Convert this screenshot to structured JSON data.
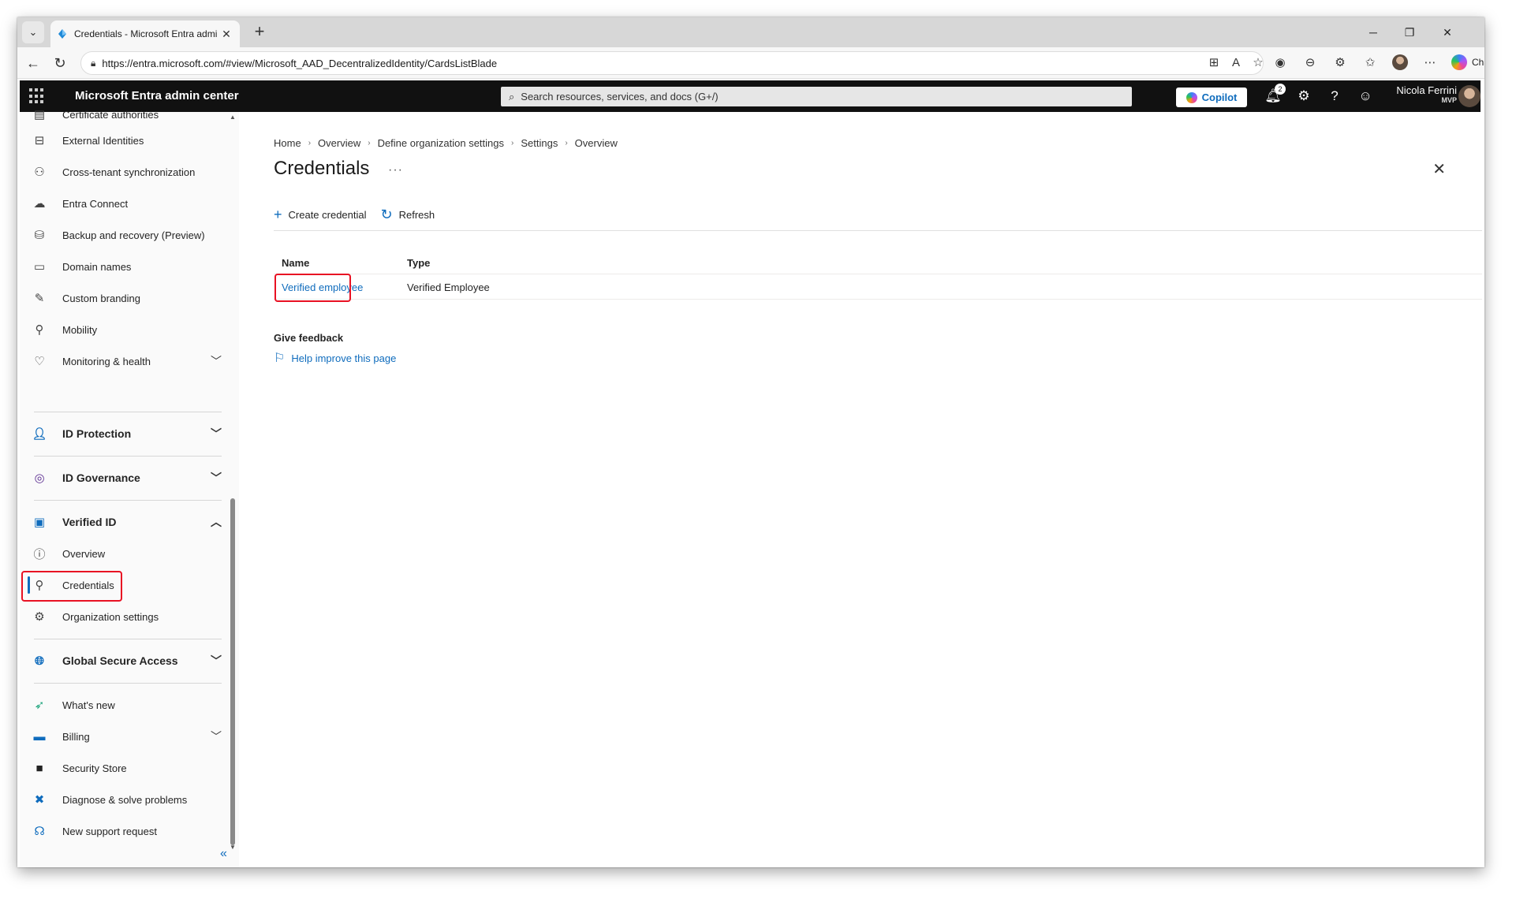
{
  "browser": {
    "tab_title": "Credentials - Microsoft Entra admi",
    "url": "https://entra.microsoft.com/#view/Microsoft_AAD_DecentralizedIdentity/CardsListBlade",
    "chat_label": "Chat"
  },
  "topbar": {
    "brand": "Microsoft Entra admin center",
    "search_placeholder": "Search resources, services, and docs (G+/)",
    "copilot_label": "Copilot",
    "notification_count": "2",
    "user_name": "Nicola Ferrini",
    "user_tag": "MVP"
  },
  "sidebar": {
    "items": [
      {
        "label": "Certificate authorities",
        "icon": "certificate-icon"
      },
      {
        "label": "External Identities",
        "icon": "external-identities-icon"
      },
      {
        "label": "Cross-tenant synchronization",
        "icon": "sync-icon"
      },
      {
        "label": "Entra Connect",
        "icon": "cloud-sync-icon"
      },
      {
        "label": "Backup and recovery (Preview)",
        "icon": "backup-icon"
      },
      {
        "label": "Domain names",
        "icon": "domain-icon"
      },
      {
        "label": "Custom branding",
        "icon": "branding-icon"
      },
      {
        "label": "Mobility",
        "icon": "mobility-icon"
      },
      {
        "label": "Monitoring & health",
        "icon": "heart-monitor-icon"
      }
    ],
    "sections": {
      "id_protection": "ID Protection",
      "id_governance": "ID Governance",
      "verified_id": "Verified ID",
      "global_secure_access": "Global Secure Access"
    },
    "verified_id_items": [
      {
        "label": "Overview",
        "icon": "info-icon"
      },
      {
        "label": "Credentials",
        "icon": "credential-search-icon"
      },
      {
        "label": "Organization settings",
        "icon": "gear-icon"
      }
    ],
    "footer_items": [
      {
        "label": "What's new",
        "icon": "rocket-icon"
      },
      {
        "label": "Billing",
        "icon": "billing-icon"
      },
      {
        "label": "Security Store",
        "icon": "store-icon"
      },
      {
        "label": "Diagnose & solve problems",
        "icon": "diagnose-icon"
      },
      {
        "label": "New support request",
        "icon": "support-icon"
      }
    ],
    "collapse_glyph": "«"
  },
  "main": {
    "breadcrumb": [
      "Home",
      "Overview",
      "Define organization settings",
      "Settings",
      "Overview"
    ],
    "title": "Credentials",
    "more_glyph": "···",
    "commands": {
      "create": "Create credential",
      "refresh": "Refresh"
    },
    "table": {
      "columns": [
        "Name",
        "Type"
      ],
      "rows": [
        {
          "name": "Verified employee",
          "type": "Verified Employee"
        }
      ]
    },
    "feedback": {
      "title": "Give feedback",
      "link": "Help improve this page"
    }
  },
  "colors": {
    "accent": "#0f6cbd",
    "topbar": "#111111",
    "highlight": "#e81123"
  }
}
